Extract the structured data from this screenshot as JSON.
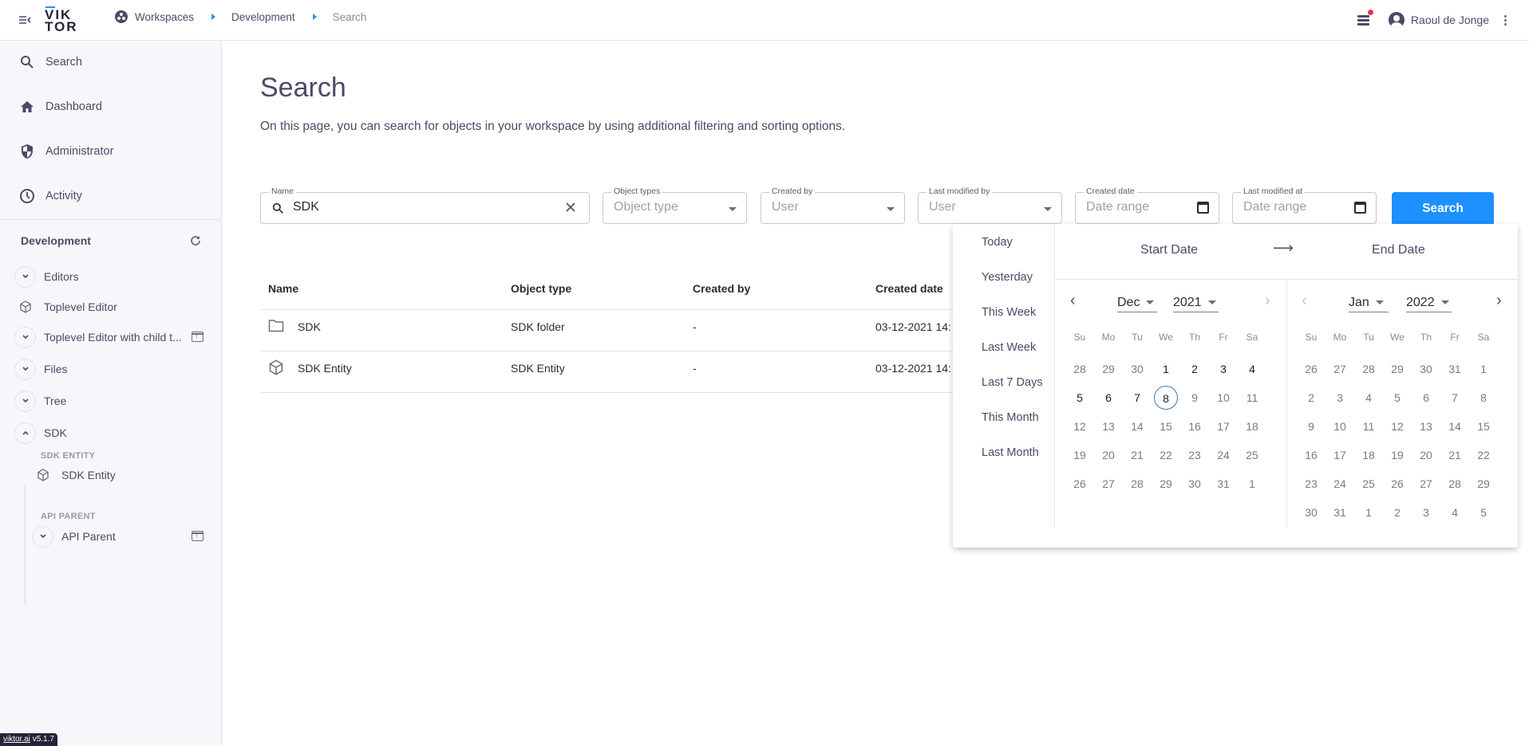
{
  "topbar": {
    "logo_line1": "VIK",
    "logo_line2": "TOR",
    "breadcrumb": [
      "Workspaces",
      "Development",
      "Search"
    ],
    "user_name": "Raoul de Jonge",
    "notification_dot_color": "#e8334a",
    "accent_color": "#1e90ff"
  },
  "sidebar": {
    "nav": [
      {
        "label": "Search",
        "icon": "search-icon"
      },
      {
        "label": "Dashboard",
        "icon": "home-icon"
      },
      {
        "label": "Administrator",
        "icon": "shield-icon"
      },
      {
        "label": "Activity",
        "icon": "clock-icon"
      }
    ],
    "section_title": "Development",
    "tree": [
      {
        "label": "Editors",
        "type": "expandable",
        "expanded": false
      },
      {
        "label": "Toplevel Editor",
        "type": "entity"
      },
      {
        "label": "Toplevel Editor with child t...",
        "type": "expandable",
        "expanded": false,
        "open_action": true
      },
      {
        "label": "Files",
        "type": "expandable",
        "expanded": false
      },
      {
        "label": "Tree",
        "type": "expandable",
        "expanded": false
      },
      {
        "label": "SDK",
        "type": "expandable",
        "expanded": true
      }
    ],
    "sdk_children": {
      "group1_label": "SDK ENTITY",
      "group1_item": "SDK Entity",
      "group2_label": "API PARENT",
      "group2_item": "API Parent"
    },
    "version_link": "viktor.ai",
    "version": "v5.1.7"
  },
  "main": {
    "title": "Search",
    "description": "On this page, you can search for objects in your workspace by using additional filtering and sorting options.",
    "filters": {
      "name": {
        "label": "Name",
        "value": "SDK"
      },
      "object_types": {
        "label": "Object types",
        "placeholder": "Object type"
      },
      "created_by": {
        "label": "Created by",
        "placeholder": "User"
      },
      "last_modified_by": {
        "label": "Last modified by",
        "placeholder": "User"
      },
      "created_date": {
        "label": "Created date",
        "placeholder": "Date range"
      },
      "last_modified_at": {
        "label": "Last modified at",
        "placeholder": "Date range"
      }
    },
    "search_button": "Search",
    "table": {
      "columns": [
        "Name",
        "Object type",
        "Created by",
        "Created date"
      ],
      "rows": [
        {
          "name": "SDK",
          "icon": "folder-icon",
          "type": "SDK folder",
          "created_by": "-",
          "created_date": "03-12-2021 14:"
        },
        {
          "name": "SDK Entity",
          "icon": "cube-icon",
          "type": "SDK Entity",
          "created_by": "-",
          "created_date": "03-12-2021 14:"
        }
      ]
    }
  },
  "date_picker": {
    "presets": [
      "Today",
      "Yesterday",
      "This Week",
      "Last Week",
      "Last 7 Days",
      "This Month",
      "Last Month"
    ],
    "start_label": "Start Date",
    "end_label": "End Date",
    "weekdays": [
      "Su",
      "Mo",
      "Tu",
      "We",
      "Th",
      "Fr",
      "Sa"
    ],
    "left": {
      "month": "Dec",
      "year": "2021",
      "days": [
        [
          "28",
          "29",
          "30",
          "1",
          "2",
          "3",
          "4"
        ],
        [
          "5",
          "6",
          "7",
          "8",
          "9",
          "10",
          "11"
        ],
        [
          "12",
          "13",
          "14",
          "15",
          "16",
          "17",
          "18"
        ],
        [
          "19",
          "20",
          "21",
          "22",
          "23",
          "24",
          "25"
        ],
        [
          "26",
          "27",
          "28",
          "29",
          "30",
          "31",
          "1"
        ]
      ],
      "today": "8",
      "active_through": "8"
    },
    "right": {
      "month": "Jan",
      "year": "2022",
      "days": [
        [
          "26",
          "27",
          "28",
          "29",
          "30",
          "31",
          "1"
        ],
        [
          "2",
          "3",
          "4",
          "5",
          "6",
          "7",
          "8"
        ],
        [
          "9",
          "10",
          "11",
          "12",
          "13",
          "14",
          "15"
        ],
        [
          "16",
          "17",
          "18",
          "19",
          "20",
          "21",
          "22"
        ],
        [
          "23",
          "24",
          "25",
          "26",
          "27",
          "28",
          "29"
        ],
        [
          "30",
          "31",
          "1",
          "2",
          "3",
          "4",
          "5"
        ]
      ]
    }
  }
}
